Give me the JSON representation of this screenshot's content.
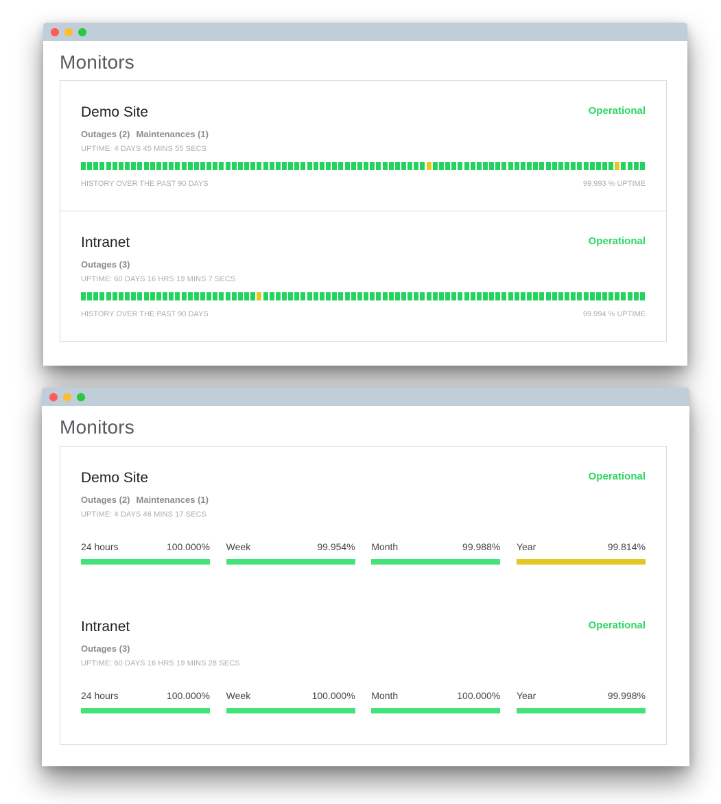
{
  "colors": {
    "operational": "#2ed663",
    "history_ok": "#22d45e",
    "history_warn": "#e2c725",
    "range_ok": "#44e37a",
    "range_warn": "#e2c725",
    "titlebar": "#c0ced9"
  },
  "windows": [
    {
      "title": "Monitors",
      "view": "history",
      "monitors": [
        {
          "name": "Demo Site",
          "status": "Operational",
          "links": [
            "Outages (2)",
            "Maintenances (1)"
          ],
          "uptime": "UPTIME: 4 DAYS 45 MINS 55 SECS",
          "history_days": 90,
          "history_warn_indices": [
            55,
            85
          ],
          "history_label": "HISTORY OVER THE PAST 90 DAYS",
          "uptime_percent": "99.993 % UPTIME"
        },
        {
          "name": "Intranet",
          "status": "Operational",
          "links": [
            "Outages (3)"
          ],
          "uptime": "UPTIME: 60 DAYS 16 HRS 19 MINS 7 SECS",
          "history_days": 90,
          "history_warn_indices": [
            28
          ],
          "history_label": "HISTORY OVER THE PAST 90 DAYS",
          "uptime_percent": "99.994 % UPTIME"
        }
      ]
    },
    {
      "title": "Monitors",
      "view": "ranges",
      "monitors": [
        {
          "name": "Demo Site",
          "status": "Operational",
          "links": [
            "Outages (2)",
            "Maintenances (1)"
          ],
          "uptime": "UPTIME: 4 DAYS 46 MINS 17 SECS",
          "ranges": [
            {
              "label": "24 hours",
              "value": "100.000%",
              "state": "ok"
            },
            {
              "label": "Week",
              "value": "99.954%",
              "state": "ok"
            },
            {
              "label": "Month",
              "value": "99.988%",
              "state": "ok"
            },
            {
              "label": "Year",
              "value": "99.814%",
              "state": "warn"
            }
          ]
        },
        {
          "name": "Intranet",
          "status": "Operational",
          "links": [
            "Outages (3)"
          ],
          "uptime": "UPTIME: 60 DAYS 16 HRS 19 MINS 28 SECS",
          "ranges": [
            {
              "label": "24 hours",
              "value": "100.000%",
              "state": "ok"
            },
            {
              "label": "Week",
              "value": "100.000%",
              "state": "ok"
            },
            {
              "label": "Month",
              "value": "100.000%",
              "state": "ok"
            },
            {
              "label": "Year",
              "value": "99.998%",
              "state": "ok"
            }
          ]
        }
      ]
    }
  ]
}
